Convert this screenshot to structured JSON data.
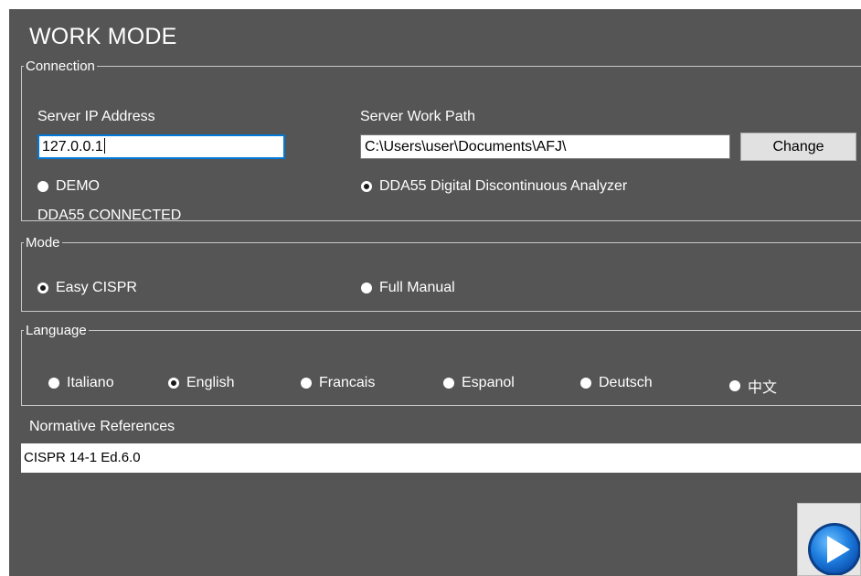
{
  "window": {
    "title": "WORK MODE"
  },
  "connection": {
    "legend": "Connection",
    "server_ip_label": "Server IP Address",
    "server_ip_value": "127.0.0.1",
    "work_path_label": "Server Work Path",
    "work_path_value": "C:\\Users\\user\\Documents\\AFJ\\",
    "change_label": "Change",
    "demo_label": "DEMO",
    "demo_selected": false,
    "dda55_label": "DDA55 Digital Discontinuous Analyzer",
    "dda55_selected": true,
    "status_text": "DDA55 CONNECTED"
  },
  "mode": {
    "legend": "Mode",
    "options": [
      {
        "label": "Easy CISPR",
        "selected": true
      },
      {
        "label": "Full Manual",
        "selected": false
      }
    ]
  },
  "language": {
    "legend": "Language",
    "options": [
      {
        "label": "Italiano",
        "selected": false
      },
      {
        "label": "English",
        "selected": true
      },
      {
        "label": "Francais",
        "selected": false
      },
      {
        "label": "Espanol",
        "selected": false
      },
      {
        "label": "Deutsch",
        "selected": false
      },
      {
        "label": "中文",
        "selected": false
      }
    ]
  },
  "normative": {
    "label": "Normative References",
    "selected": "CISPR 14-1 Ed.6.0"
  },
  "actions": {
    "start_icon": "play-icon"
  },
  "colors": {
    "panel_bg": "#555555",
    "focus_border": "#0078d7",
    "play_blue": "#1f7fe0"
  }
}
